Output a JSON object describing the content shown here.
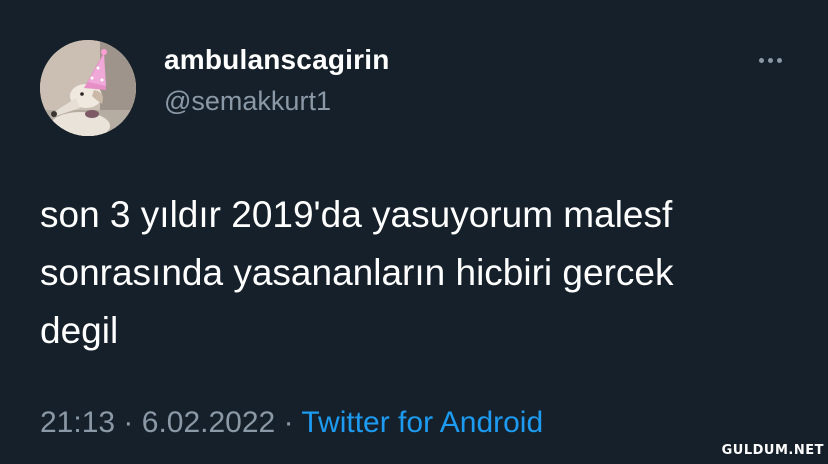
{
  "tweet": {
    "display_name": "ambulanscagirin",
    "handle": "@semakkurt1",
    "text": "son 3 yıldır 2019'da yasuyorum malesf\nsonrasında yasananların hicbiri gercek\ndegil",
    "time": "21:13",
    "separator_1": "·",
    "date": "6.02.2022",
    "separator_2": "·",
    "source": "Twitter for Android"
  },
  "icons": {
    "more": "more-horizontal-icon",
    "avatar": "dog-with-party-hat"
  },
  "colors": {
    "background": "#15202b",
    "primary_text": "#ffffff",
    "secondary_text": "#8b98a5",
    "link": "#1d9bf0"
  },
  "watermark": "GULDUM.NET"
}
